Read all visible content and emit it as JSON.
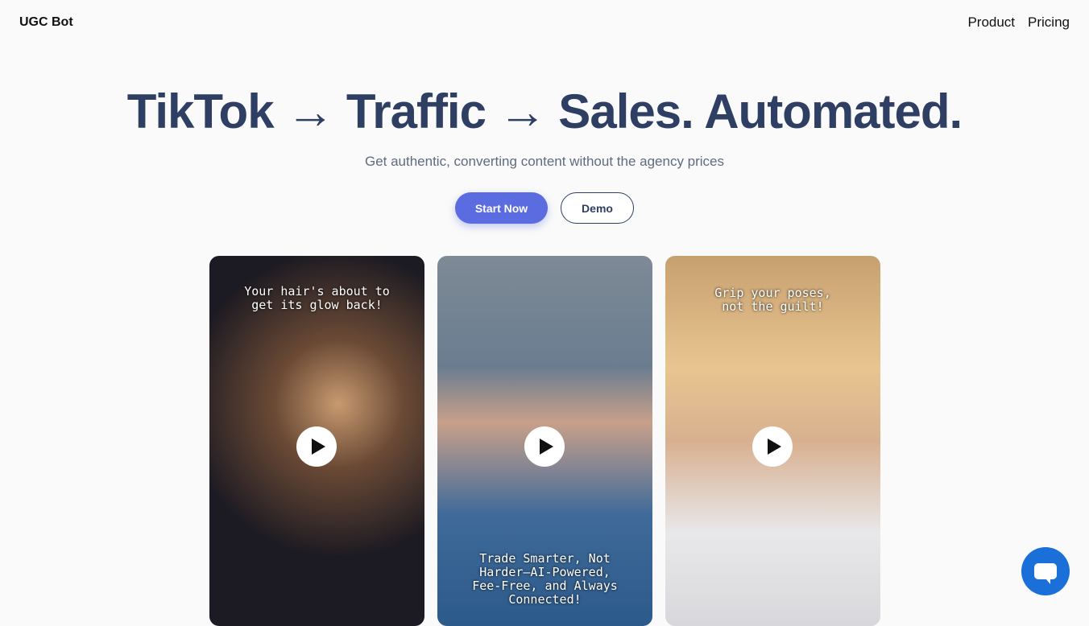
{
  "nav": {
    "logo": "UGC Bot",
    "links": [
      "Product",
      "Pricing"
    ]
  },
  "hero": {
    "title": "TikTok → Traffic → Sales. Automated.",
    "subtitle": "Get authentic, converting content without the agency prices",
    "start": "Start Now",
    "demo": "Demo"
  },
  "videos": [
    {
      "caption": "Your hair's about to get its glow back!"
    },
    {
      "caption": "Trade Smarter, Not Harder—AI-Powered, Fee-Free, and Always Connected!"
    },
    {
      "caption": "Grip your poses, not the guilt!"
    }
  ]
}
